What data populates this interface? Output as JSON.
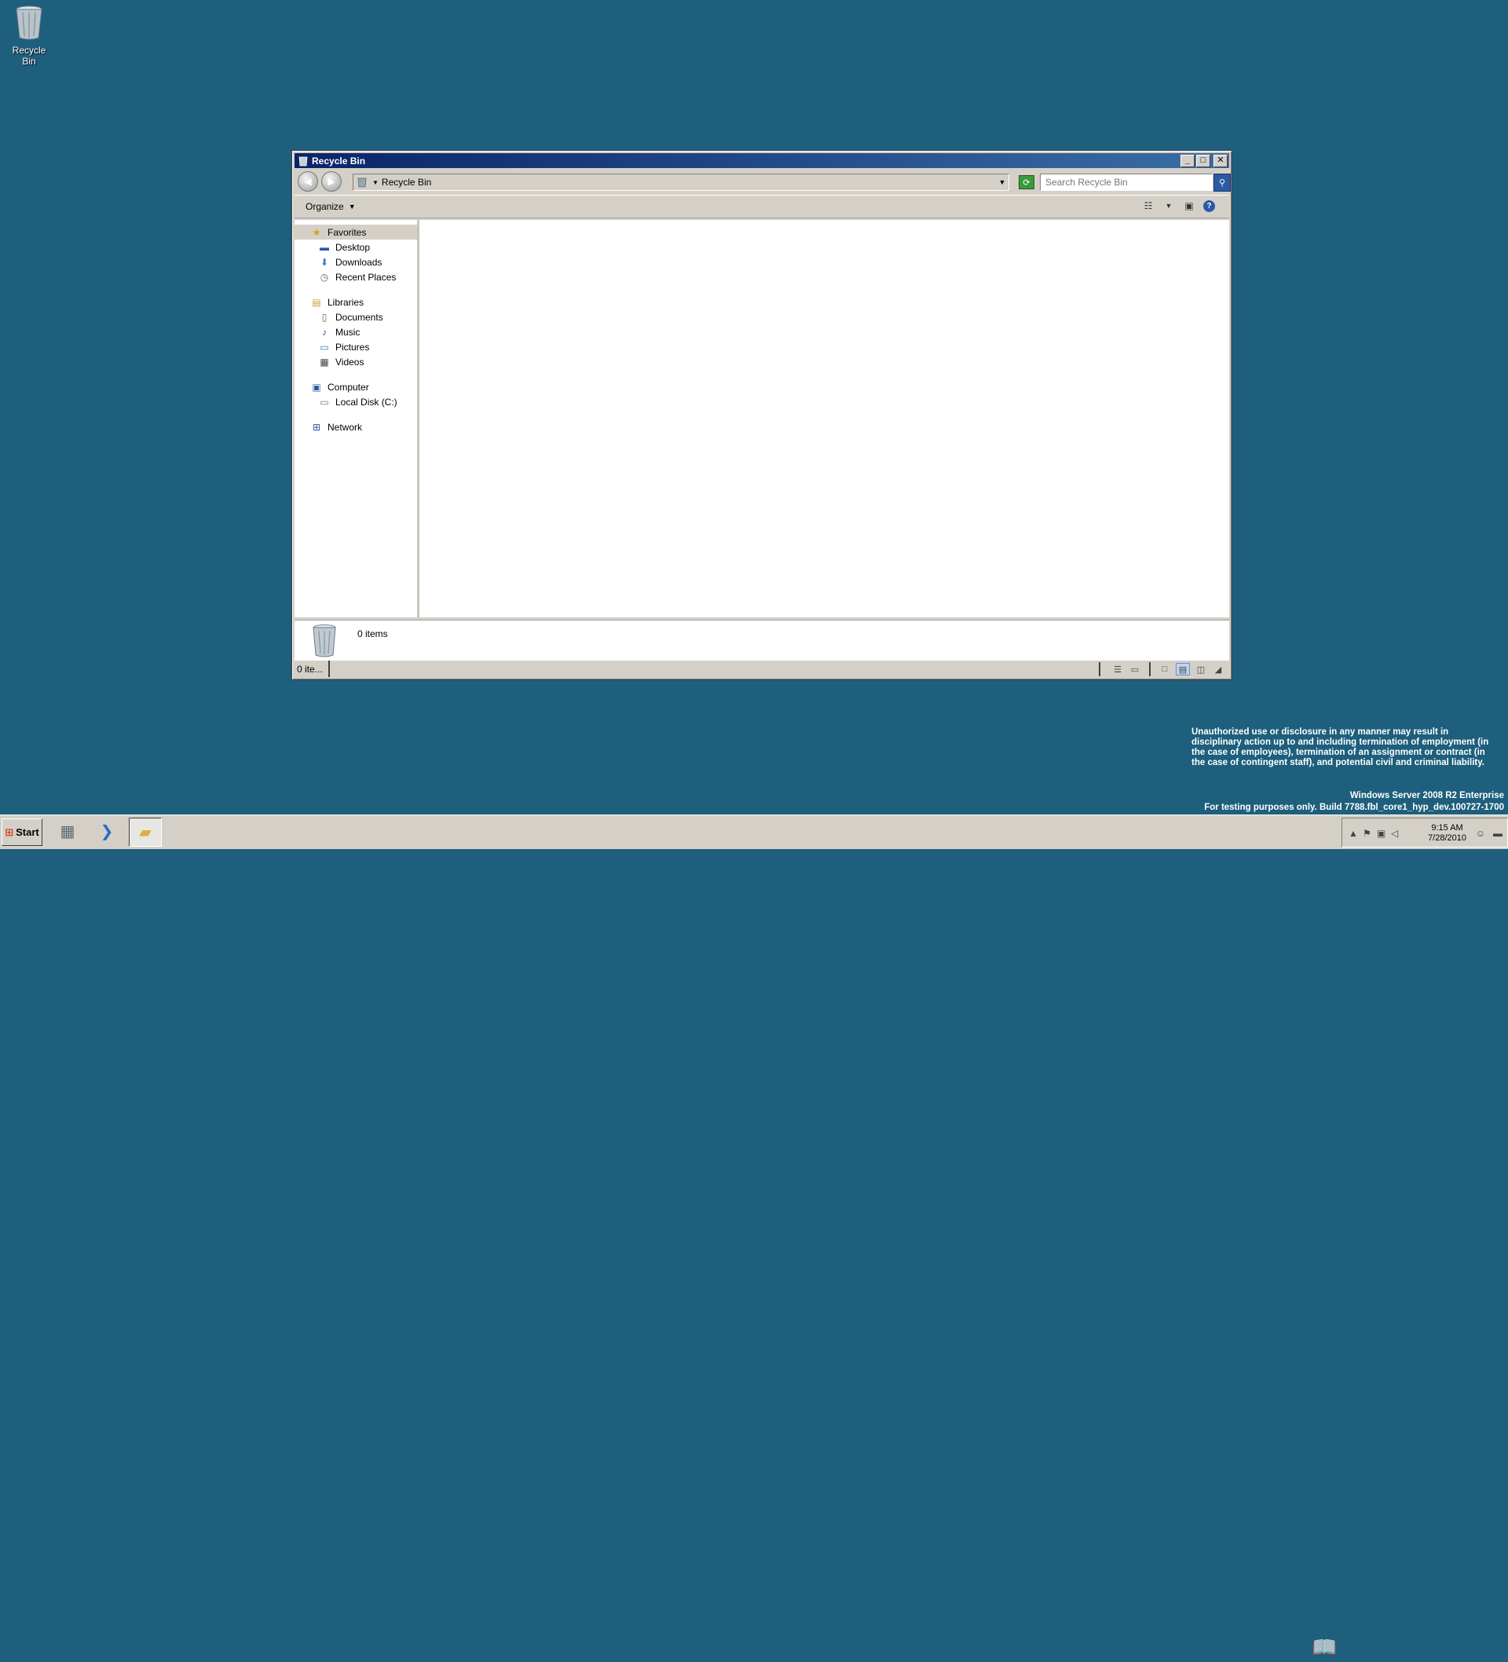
{
  "desktop": {
    "icons": [
      {
        "label": "Recycle Bin",
        "icon": "recycle-bin-icon"
      }
    ]
  },
  "window": {
    "title": "Recycle Bin",
    "address": {
      "path": "Recycle Bin"
    },
    "search": {
      "placeholder": "Search Recycle Bin"
    },
    "toolbar": {
      "organize_label": "Organize"
    },
    "nav": {
      "favorites": {
        "label": "Favorites",
        "items": [
          "Desktop",
          "Downloads",
          "Recent Places"
        ]
      },
      "libraries": {
        "label": "Libraries",
        "items": [
          "Documents",
          "Music",
          "Pictures",
          "Videos"
        ]
      },
      "computer": {
        "label": "Computer",
        "items": [
          "Local Disk (C:)"
        ]
      },
      "network": {
        "label": "Network"
      }
    },
    "details": {
      "count": "0 items"
    },
    "status": {
      "text": "0 ite..."
    }
  },
  "notice": {
    "text": "Unauthorized use or disclosure in any manner may result in disciplinary action up to and including termination of employment (in the case of employees), termination of an assignment or contract (in the case of contingent staff), and potential civil and criminal liability.",
    "edition": "Windows Server 2008 R2 Enterprise",
    "build": "For testing purposes only. Build 7788.fbl_core1_hyp_dev.100727-1700"
  },
  "taskbar": {
    "start_label": "Start",
    "clock": {
      "time": "9:15 AM",
      "date": "7/28/2010"
    }
  },
  "colors": {
    "desktop": "#1d5f7c",
    "title_start": "#0a246a",
    "title_end": "#3a6ea5",
    "chrome": "#d4d0c8"
  }
}
